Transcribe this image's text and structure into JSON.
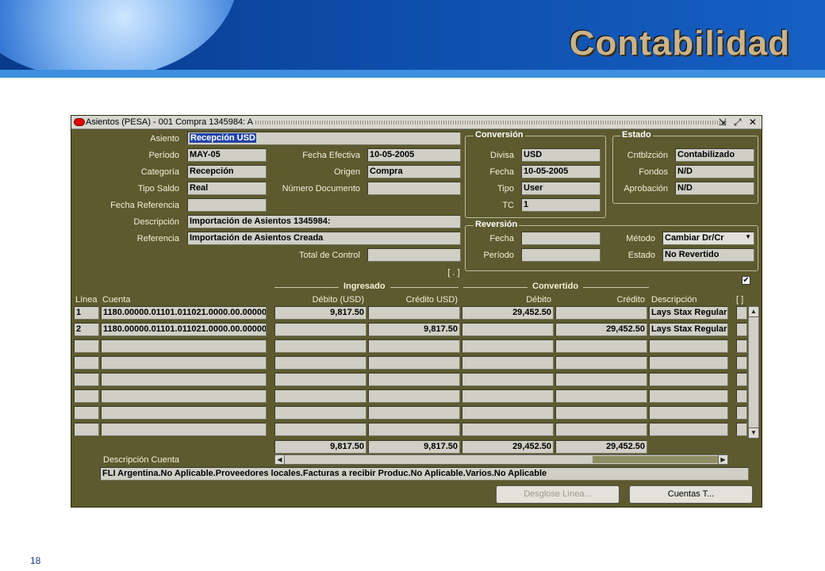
{
  "slide": {
    "title": "Contabilidad",
    "page_number": "18"
  },
  "window": {
    "title": "Asientos (PESA) - 001 Compra 1345984: A",
    "controls": "⇲ ⤢ ✕"
  },
  "header": {
    "asiento_label": "Asiento",
    "asiento": "Recepción USD",
    "periodo_label": "Período",
    "periodo": "MAY-05",
    "categoria_label": "Categoría",
    "categoria": "Recepción",
    "tipo_saldo_label": "Tipo Saldo",
    "tipo_saldo": "Real",
    "fecha_ref_label": "Fecha Referencia",
    "fecha_ref": "",
    "descripcion_label": "Descripción",
    "descripcion": "Importación de Asientos 1345984:",
    "referencia_label": "Referencia",
    "referencia": "Importación de Asientos Creada",
    "fecha_efectiva_label": "Fecha Efectiva",
    "fecha_efectiva": "10-05-2005",
    "origen_label": "Origen",
    "origen": "Compra",
    "numero_doc_label": "Número Documento",
    "numero_doc": "",
    "total_control_label": "Total de Control",
    "total_control": "",
    "bracket_btn": "[ . ]"
  },
  "conversion": {
    "title": "Conversión",
    "divisa_label": "Divisa",
    "divisa": "USD",
    "fecha_label": "Fecha",
    "fecha": "10-05-2005",
    "tipo_label": "Tipo",
    "tipo": "User",
    "tc_label": "TC",
    "tc": "1"
  },
  "estado": {
    "title": "Estado",
    "cntblzcion_label": "Cntblzción",
    "cntblzcion": "Contabilizado",
    "fondos_label": "Fondos",
    "fondos": "N/D",
    "aprobacion_label": "Aprobación",
    "aprobacion": "N/D"
  },
  "reversion": {
    "title": "Reversión",
    "fecha_label": "Fecha",
    "fecha": "",
    "periodo_label": "Período",
    "periodo": "",
    "metodo_label": "Método",
    "metodo": "Cambiar Dr/Cr",
    "estado_label": "Estado",
    "estado": "No Revertido"
  },
  "lines": {
    "group_ingresado": "Ingresado",
    "group_convertido": "Convertido",
    "columns": {
      "linea": "Línea",
      "cuenta": "Cuenta",
      "debito_usd": "Débito (USD)",
      "credito_usd": "Crédito USD)",
      "debito": "Débito",
      "credito": "Crédito",
      "descripcion": "Descripción",
      "folder": "[ ]"
    },
    "rows": [
      {
        "linea": "1",
        "cuenta": "1180.00000.01101.011021.0000.00.00000",
        "debito_usd": "9,817.50",
        "credito_usd": "",
        "debito": "29,452.50",
        "credito": "",
        "descripcion": "Lays  Stax Regular"
      },
      {
        "linea": "2",
        "cuenta": "1180.00000.01101.011021.0000.00.00000",
        "debito_usd": "",
        "credito_usd": "9,817.50",
        "debito": "",
        "credito": "29,452.50",
        "descripcion": "Lays  Stax Regular"
      },
      {
        "linea": "",
        "cuenta": "",
        "debito_usd": "",
        "credito_usd": "",
        "debito": "",
        "credito": "",
        "descripcion": ""
      },
      {
        "linea": "",
        "cuenta": "",
        "debito_usd": "",
        "credito_usd": "",
        "debito": "",
        "credito": "",
        "descripcion": ""
      },
      {
        "linea": "",
        "cuenta": "",
        "debito_usd": "",
        "credito_usd": "",
        "debito": "",
        "credito": "",
        "descripcion": ""
      },
      {
        "linea": "",
        "cuenta": "",
        "debito_usd": "",
        "credito_usd": "",
        "debito": "",
        "credito": "",
        "descripcion": ""
      },
      {
        "linea": "",
        "cuenta": "",
        "debito_usd": "",
        "credito_usd": "",
        "debito": "",
        "credito": "",
        "descripcion": ""
      },
      {
        "linea": "",
        "cuenta": "",
        "debito_usd": "",
        "credito_usd": "",
        "debito": "",
        "credito": "",
        "descripcion": ""
      }
    ],
    "totals": {
      "debito_usd": "9,817.50",
      "credito_usd": "9,817.50",
      "debito": "29,452.50",
      "credito": "29,452.50"
    },
    "desc_cuenta_label": "Descripción Cuenta",
    "desc_cuenta": "FLI Argentina.No Aplicable.Proveedores locales.Facturas a recibir Produc.No Aplicable.Varios.No Aplicable"
  },
  "buttons": {
    "desglose": "Desglose Línea...",
    "cuentas": "Cuentas T..."
  }
}
